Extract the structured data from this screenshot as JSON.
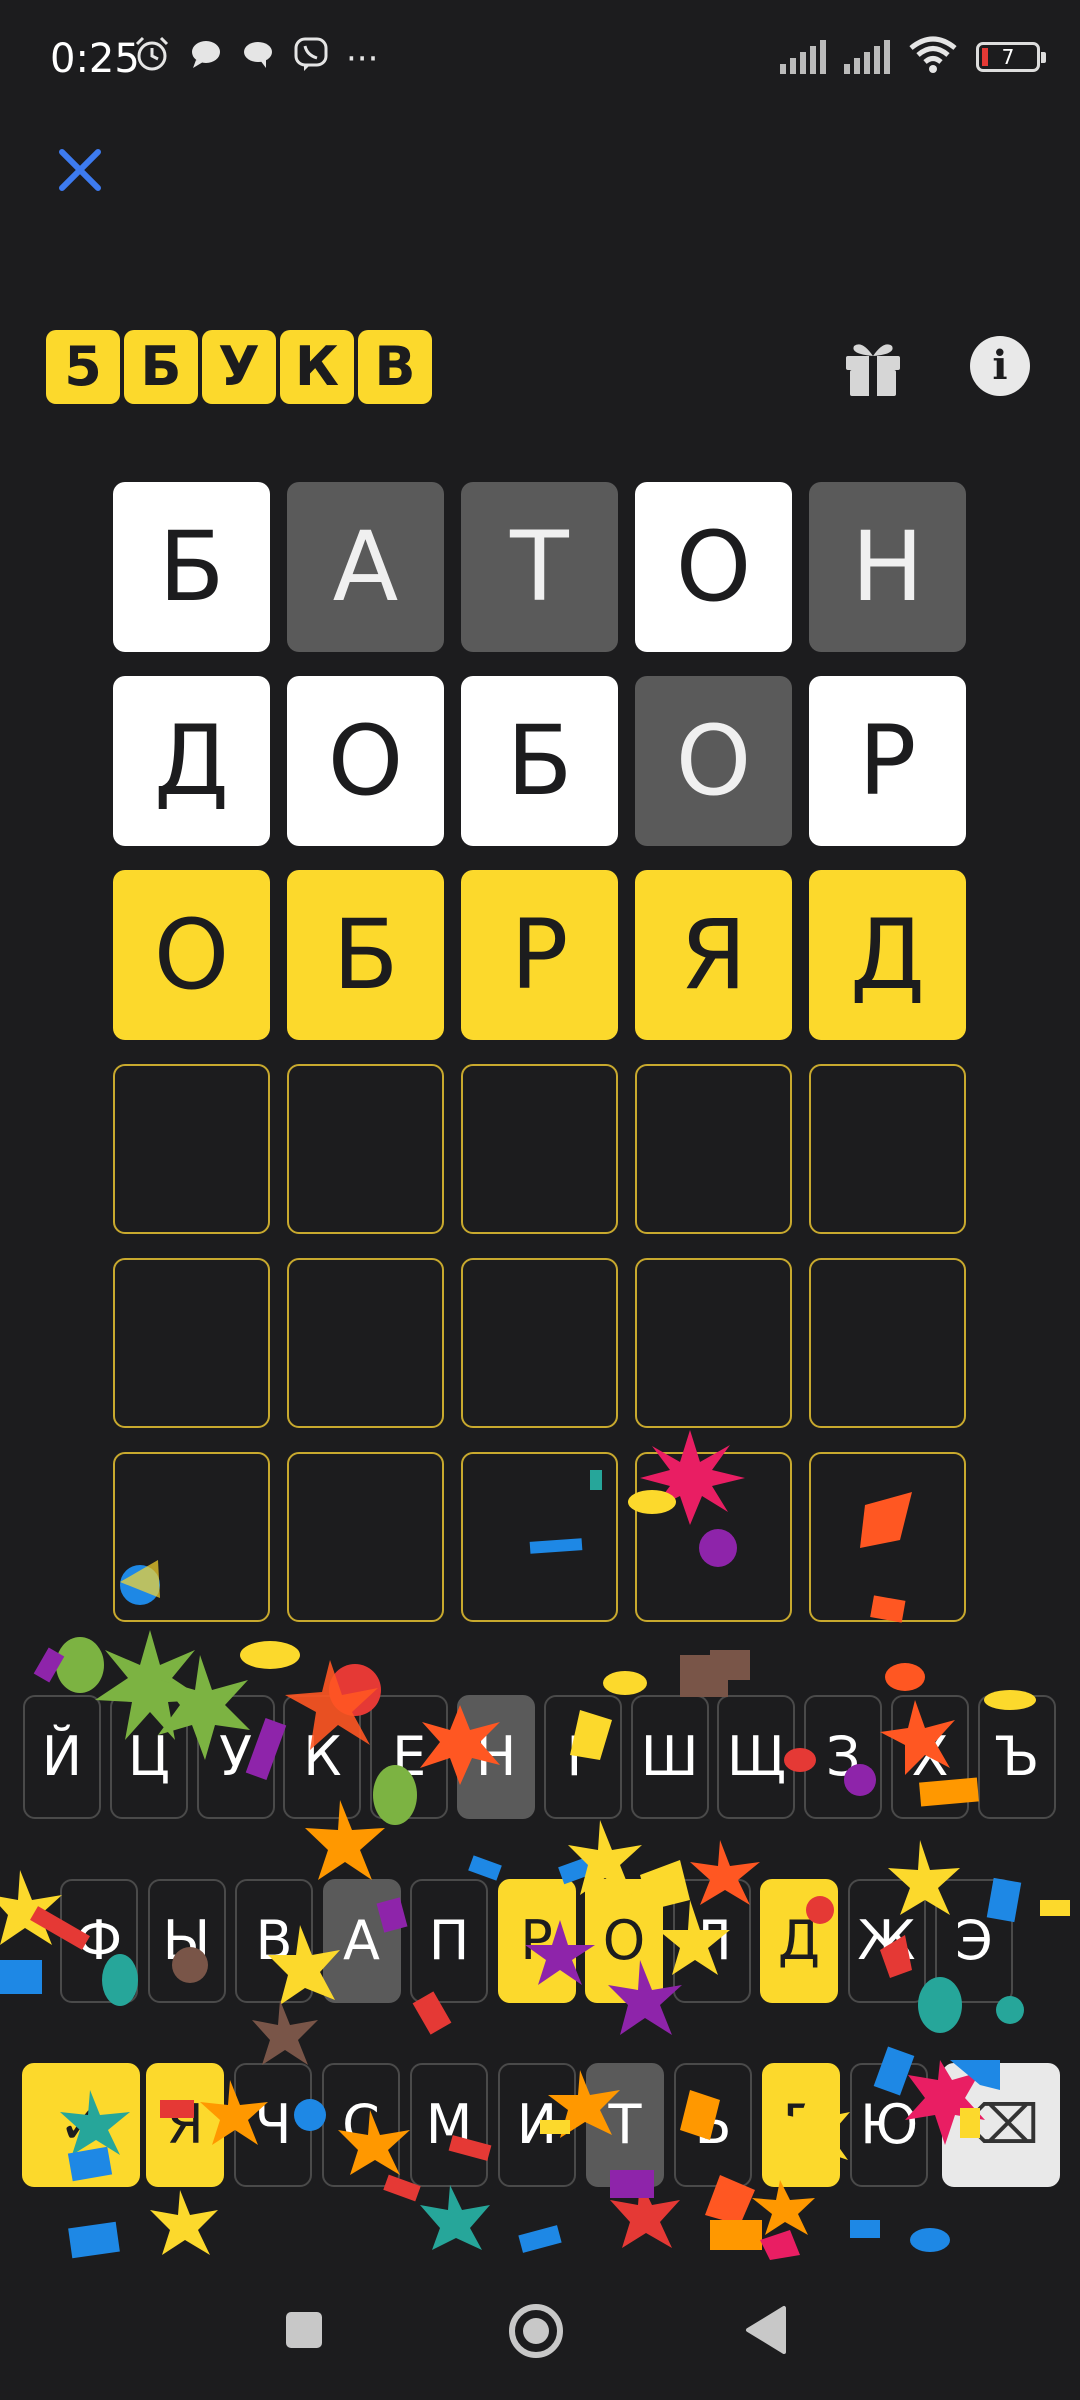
{
  "status_bar": {
    "time": "0:25",
    "battery": "7",
    "more": "···"
  },
  "logo": {
    "tiles": [
      "5",
      "Б",
      "У",
      "К",
      "В"
    ]
  },
  "board": {
    "rows": [
      [
        {
          "letter": "Б",
          "state": "correct"
        },
        {
          "letter": "А",
          "state": "absent"
        },
        {
          "letter": "Т",
          "state": "absent"
        },
        {
          "letter": "О",
          "state": "correct"
        },
        {
          "letter": "Н",
          "state": "absent"
        }
      ],
      [
        {
          "letter": "Д",
          "state": "correct"
        },
        {
          "letter": "О",
          "state": "correct"
        },
        {
          "letter": "Б",
          "state": "correct"
        },
        {
          "letter": "О",
          "state": "absent"
        },
        {
          "letter": "Р",
          "state": "correct"
        }
      ],
      [
        {
          "letter": "О",
          "state": "current"
        },
        {
          "letter": "Б",
          "state": "current"
        },
        {
          "letter": "Р",
          "state": "current"
        },
        {
          "letter": "Я",
          "state": "current"
        },
        {
          "letter": "Д",
          "state": "current"
        }
      ],
      [
        {
          "letter": "",
          "state": "empty"
        },
        {
          "letter": "",
          "state": "empty"
        },
        {
          "letter": "",
          "state": "empty"
        },
        {
          "letter": "",
          "state": "empty"
        },
        {
          "letter": "",
          "state": "empty"
        }
      ],
      [
        {
          "letter": "",
          "state": "empty"
        },
        {
          "letter": "",
          "state": "empty"
        },
        {
          "letter": "",
          "state": "empty"
        },
        {
          "letter": "",
          "state": "empty"
        },
        {
          "letter": "",
          "state": "empty"
        }
      ],
      [
        {
          "letter": "",
          "state": "empty"
        },
        {
          "letter": "",
          "state": "empty"
        },
        {
          "letter": "",
          "state": "empty"
        },
        {
          "letter": "",
          "state": "empty"
        },
        {
          "letter": "",
          "state": "empty"
        }
      ]
    ]
  },
  "keyboard": {
    "rows": [
      [
        {
          "label": "Й",
          "state": "default"
        },
        {
          "label": "Ц",
          "state": "default"
        },
        {
          "label": "У",
          "state": "default"
        },
        {
          "label": "К",
          "state": "default"
        },
        {
          "label": "Е",
          "state": "default"
        },
        {
          "label": "Н",
          "state": "absent"
        },
        {
          "label": "Г",
          "state": "default"
        },
        {
          "label": "Ш",
          "state": "default"
        },
        {
          "label": "Щ",
          "state": "default"
        },
        {
          "label": "З",
          "state": "default"
        },
        {
          "label": "Х",
          "state": "default"
        },
        {
          "label": "Ъ",
          "state": "default"
        }
      ],
      [
        {
          "label": "Ф",
          "state": "default"
        },
        {
          "label": "Ы",
          "state": "default"
        },
        {
          "label": "В",
          "state": "default"
        },
        {
          "label": "А",
          "state": "absent"
        },
        {
          "label": "П",
          "state": "default"
        },
        {
          "label": "Р",
          "state": "present"
        },
        {
          "label": "О",
          "state": "present"
        },
        {
          "label": "Л",
          "state": "default"
        },
        {
          "label": "Д",
          "state": "present"
        },
        {
          "label": "Ж",
          "state": "default"
        },
        {
          "label": "Э",
          "state": "default"
        }
      ],
      [
        {
          "label": "✓",
          "state": "enter"
        },
        {
          "label": "Я",
          "state": "present"
        },
        {
          "label": "Ч",
          "state": "default"
        },
        {
          "label": "С",
          "state": "default"
        },
        {
          "label": "М",
          "state": "default"
        },
        {
          "label": "И",
          "state": "default"
        },
        {
          "label": "Т",
          "state": "absent"
        },
        {
          "label": "Ь",
          "state": "default"
        },
        {
          "label": "Б",
          "state": "present"
        },
        {
          "label": "Ю",
          "state": "default"
        },
        {
          "label": "⌫",
          "state": "backspace"
        }
      ]
    ]
  },
  "colors": {
    "background": "#1c1c1e",
    "accent_yellow": "#fcd92c",
    "absent_gray": "#5a5a5a",
    "correct_white": "#ffffff",
    "close_blue": "#3d7bf0"
  },
  "icons": {
    "close": "close-icon",
    "gift": "gift-icon",
    "info": "info-icon",
    "nav_recents": "square-icon",
    "nav_home": "circle-icon",
    "nav_back": "triangle-back-icon"
  }
}
